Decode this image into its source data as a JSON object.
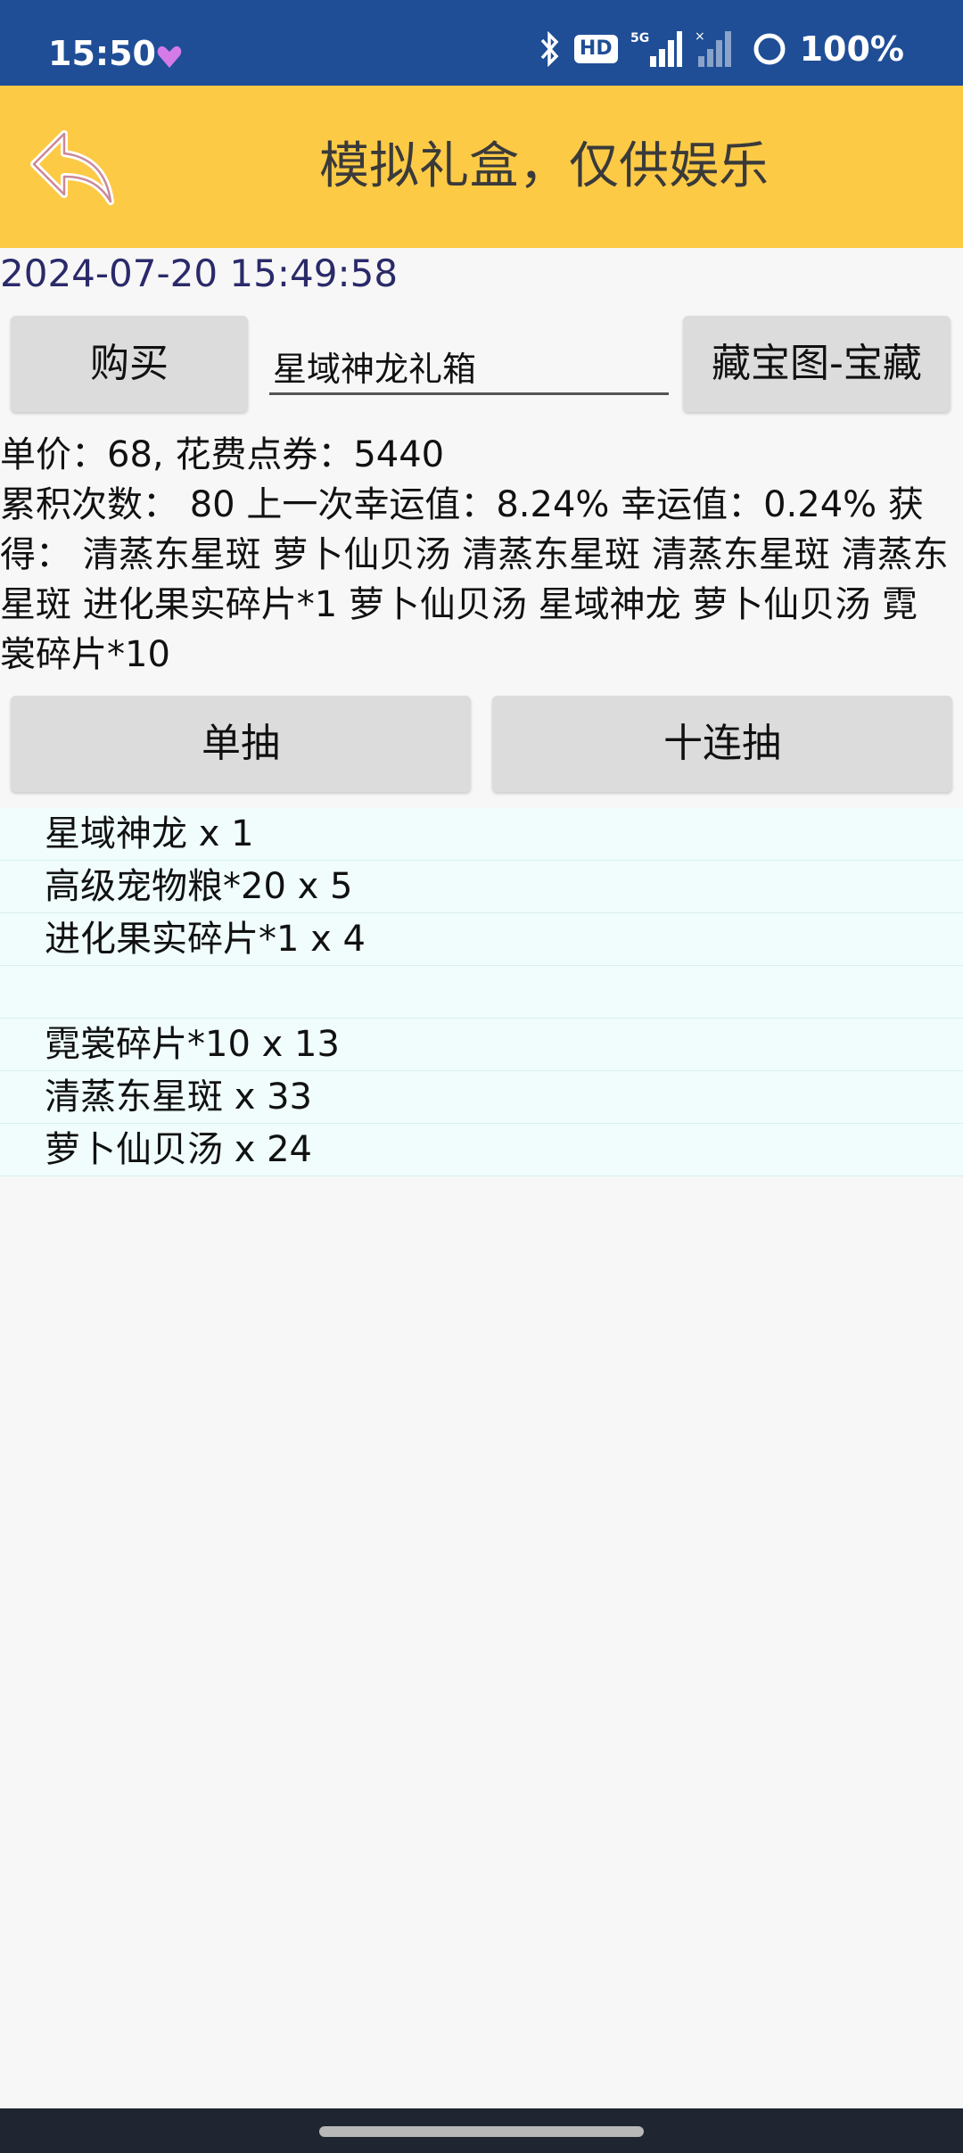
{
  "status_bar": {
    "time": "15:50",
    "battery": "100%",
    "hd": "HD",
    "network": "5G"
  },
  "header": {
    "title": "模拟礼盒，仅供娱乐",
    "back_icon": "back-arrow-icon",
    "color": "#fcca45"
  },
  "timestamp": "2024-07-20 15:49:58",
  "actions": {
    "buy_label": "购买",
    "box_name": "星域神龙礼箱",
    "treasure_label": "藏宝图-宝藏",
    "draw_one_label": "单抽",
    "draw_ten_label": "十连抽"
  },
  "info": {
    "price_line": "单价：68, 花费点券：5440",
    "draw_summary": "累积次数： 80 上一次幸运值：8.24% 幸运值：0.24% 获得：  清蒸东星斑 萝卜仙贝汤 清蒸东星斑 清蒸东星斑 清蒸东星斑 进化果实碎片*1 萝卜仙贝汤 星域神龙 萝卜仙贝汤 霓裳碎片*10"
  },
  "results": [
    "星域神龙 x 1",
    "高级宠物粮*20 x 5",
    "进化果实碎片*1 x 4",
    "",
    "霓裳碎片*10 x 13",
    "清蒸东星斑 x 33",
    "萝卜仙贝汤 x 24"
  ]
}
